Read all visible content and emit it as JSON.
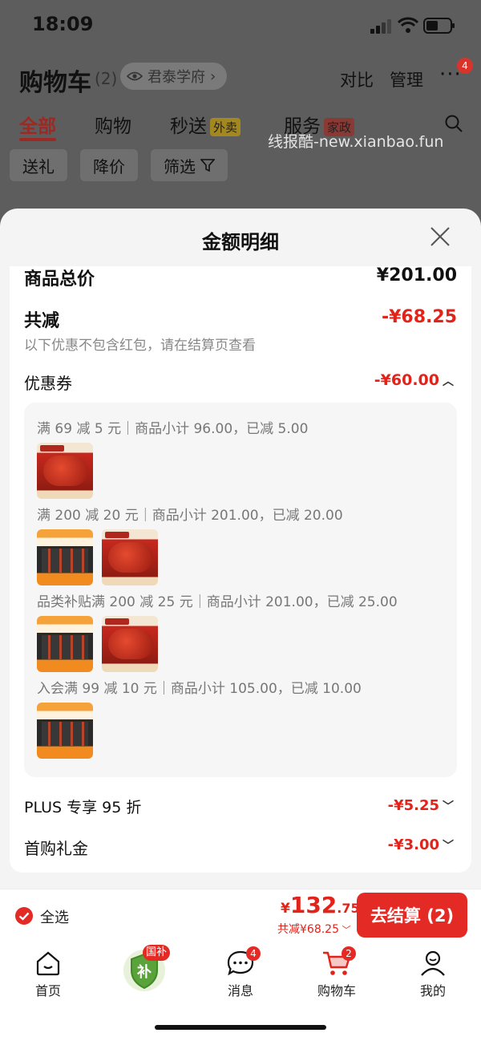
{
  "status_bar": {
    "time": "18:09"
  },
  "header": {
    "title": "购物车",
    "count": "(2)",
    "location": "君泰学府",
    "compare": "对比",
    "manage": "管理",
    "more_badge": "4"
  },
  "tabs": [
    {
      "label": "全部"
    },
    {
      "label": "购物"
    },
    {
      "label": "秒送",
      "tag": "外卖"
    },
    {
      "label": "服务",
      "tag": "家政"
    }
  ],
  "filters": [
    "送礼",
    "降价",
    "筛选"
  ],
  "watermark": "线报酷-new.xianbao.fun",
  "sheet": {
    "title": "金额明细",
    "total_label": "商品总价",
    "total_value": "¥201.00",
    "reduce_label": "共减",
    "reduce_value": "-¥68.25",
    "note": "以下优惠不包含红包，请在结算页查看",
    "coupon_label": "优惠券",
    "coupon_value": "-¥60.00",
    "coupon_details": [
      "满 69 减 5 元｜商品小计 96.00，已减 5.00",
      "满 200 减 20 元｜商品小计 201.00，已减 20.00",
      "品类补贴满 200 减 25 元｜商品小计 201.00，已减 25.00",
      "入会满 99 减 10 元｜商品小计 105.00，已减 10.00"
    ],
    "plus_label": "PLUS 专享 95 折",
    "plus_value": "-¥5.25",
    "gift_label": "首购礼金",
    "gift_value": "-¥3.00"
  },
  "checkout": {
    "select_all": "全选",
    "currency": "¥",
    "total_int": "132",
    "total_dec": ".75",
    "saved": "共减¥68.25",
    "pay_button": "去结算 (2)"
  },
  "tabbar": [
    {
      "label": "首页"
    },
    {
      "label": "",
      "badge": "国补"
    },
    {
      "label": "消息",
      "badge": "4"
    },
    {
      "label": "购物车",
      "badge": "2"
    },
    {
      "label": "我的"
    }
  ],
  "colors": {
    "accent": "#e2231a",
    "pay_button": "#e42a24"
  }
}
